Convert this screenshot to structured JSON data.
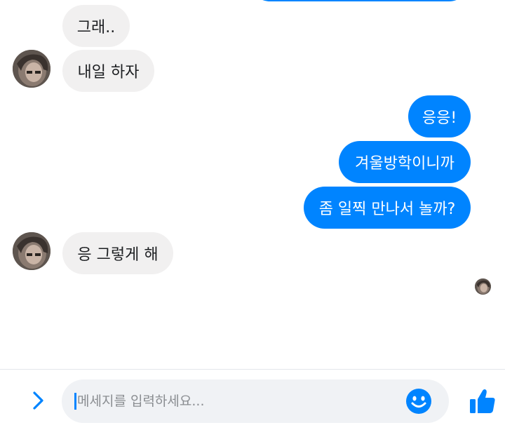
{
  "messages": [
    {
      "sender": "them",
      "text": "그래.."
    },
    {
      "sender": "them",
      "text": "내일 하자"
    },
    {
      "sender": "me",
      "text": "응응!"
    },
    {
      "sender": "me",
      "text": "겨울방학이니까"
    },
    {
      "sender": "me",
      "text": "좀 일찍 만나서 놀까?"
    },
    {
      "sender": "them",
      "text": "응 그렇게 해"
    }
  ],
  "composer": {
    "placeholder": "메세지를 입력하세요...",
    "expand_icon": "chevron-right-icon",
    "emoji_icon": "smiley-icon",
    "send_icon": "thumbs-up-icon"
  },
  "colors": {
    "outgoing_bubble": "#0084ff",
    "incoming_bubble": "#f1f0f0",
    "accent": "#0084ff"
  }
}
